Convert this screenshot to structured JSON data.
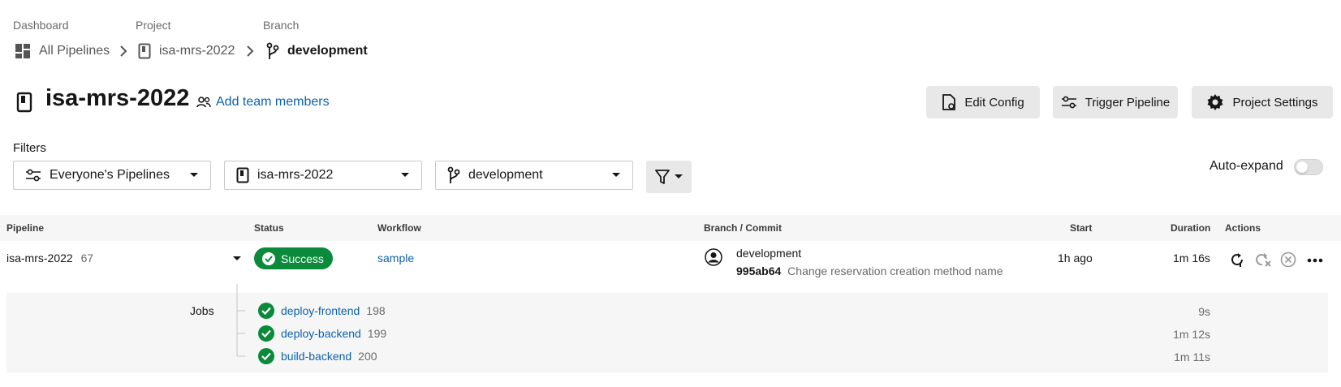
{
  "breadcrumb": {
    "dashboard_label": "Dashboard",
    "dashboard_value": "All Pipelines",
    "project_label": "Project",
    "project_value": "isa-mrs-2022",
    "branch_label": "Branch",
    "branch_value": "development"
  },
  "header": {
    "title": "isa-mrs-2022",
    "add_team": "Add team members",
    "edit_config": "Edit Config",
    "trigger_pipeline": "Trigger Pipeline",
    "project_settings": "Project Settings"
  },
  "filters": {
    "label": "Filters",
    "pipelines": "Everyone's Pipelines",
    "project": "isa-mrs-2022",
    "branch": "development",
    "auto_expand": "Auto-expand",
    "auto_expand_on": false
  },
  "table": {
    "columns": {
      "pipeline": "Pipeline",
      "status": "Status",
      "workflow": "Workflow",
      "branch_commit": "Branch / Commit",
      "start": "Start",
      "duration": "Duration",
      "actions": "Actions"
    },
    "row": {
      "pipeline": "isa-mrs-2022",
      "number": "67",
      "status": "Success",
      "workflow": "sample",
      "branch": "development",
      "commit_hash": "995ab64",
      "commit_message": "Change reservation creation method name",
      "start": "1h ago",
      "duration": "1m 16s"
    },
    "jobs_label": "Jobs",
    "jobs": [
      {
        "name": "deploy-frontend",
        "number": "198",
        "duration": "9s"
      },
      {
        "name": "deploy-backend",
        "number": "199",
        "duration": "1m 12s"
      },
      {
        "name": "build-backend",
        "number": "200",
        "duration": "1m 11s"
      }
    ]
  },
  "colors": {
    "success": "#0a8a3a",
    "link": "#0b62ad",
    "button_bg": "#e8e8e8"
  },
  "icons": [
    "dashboard-icon",
    "book-icon",
    "branch-icon",
    "chevron-right-icon",
    "people-icon",
    "file-settings-icon",
    "sliders-icon",
    "gear-icon",
    "caret-down-icon",
    "filter-icon",
    "check-circle-icon",
    "avatar-icon",
    "rerun-icon",
    "rerun-failed-icon",
    "cancel-icon",
    "more-icon"
  ]
}
